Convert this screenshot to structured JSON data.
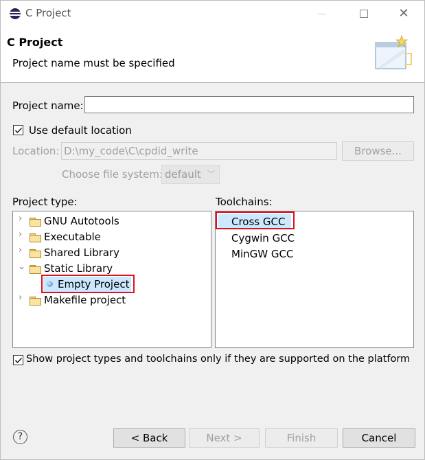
{
  "window": {
    "title": "C Project"
  },
  "header": {
    "title": "C Project",
    "message": "Project name must be specified"
  },
  "form": {
    "project_name_label": "Project name:",
    "project_name_value": "",
    "use_default_location_label": "Use default location",
    "use_default_location_checked": true,
    "location_label": "Location:",
    "location_value": "D:\\my_code\\C\\cpdid_write",
    "browse_label": "Browse...",
    "file_system_label": "Choose file system:",
    "file_system_value": "default"
  },
  "project_type": {
    "label": "Project type:",
    "items": [
      {
        "label": "GNU Autotools",
        "expanded": false
      },
      {
        "label": "Executable",
        "expanded": false
      },
      {
        "label": "Shared Library",
        "expanded": false
      },
      {
        "label": "Static Library",
        "expanded": true
      },
      {
        "label": "Empty Project",
        "child": true,
        "selected": true
      },
      {
        "label": "Makefile project",
        "expanded": false
      }
    ]
  },
  "toolchains": {
    "label": "Toolchains:",
    "items": [
      {
        "label": "Cross GCC",
        "selected": true
      },
      {
        "label": "Cygwin GCC"
      },
      {
        "label": "MinGW GCC"
      }
    ]
  },
  "filter": {
    "label": "Show project types and toolchains only if they are supported on the platform",
    "checked": true
  },
  "buttons": {
    "back": "< Back",
    "next": "Next >",
    "finish": "Finish",
    "cancel": "Cancel"
  },
  "colors": {
    "highlight_box": "#e0101a",
    "selection": "#cce8ff"
  }
}
